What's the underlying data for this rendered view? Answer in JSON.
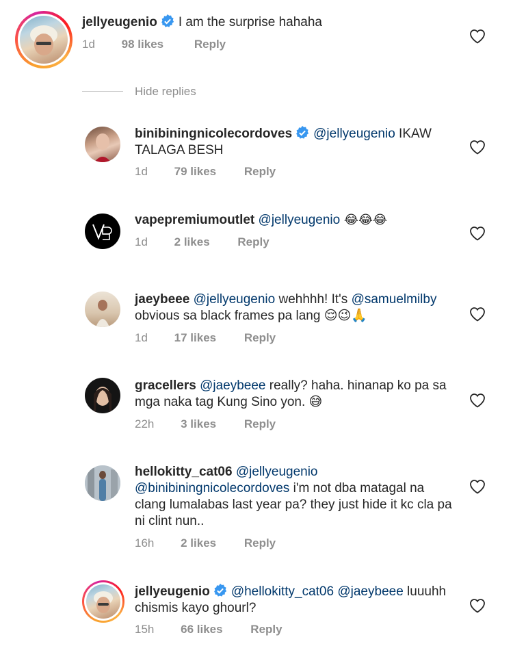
{
  "hide_replies": "Hide replies",
  "comments": [
    {
      "username": "jellyeugenio",
      "verified": true,
      "mention": "",
      "text": "I am the surprise hahaha",
      "time": "1d",
      "likes": "98 likes",
      "reply": "Reply",
      "avatar": "jelly-avatar"
    },
    {
      "username": "binibiningnicolecordoves",
      "verified": true,
      "mention": "@jellyeugenio",
      "text": " IKAW TALAGA BESH",
      "time": "1d",
      "likes": "79 likes",
      "reply": "Reply",
      "avatar": "nicole-avatar"
    },
    {
      "username": "vapepremiumoutlet",
      "verified": false,
      "mention": "@jellyeugenio",
      "text": " 😂😂😂",
      "time": "1d",
      "likes": "2 likes",
      "reply": "Reply",
      "avatar": "vape-avatar"
    },
    {
      "username": "jaeybeee",
      "verified": false,
      "mention": "@jellyeugenio",
      "text": " wehhhh! It's ",
      "mention2": "@samuelmilby",
      "text2": " obvious sa black frames pa lang 😌😉🙏",
      "time": "1d",
      "likes": "17 likes",
      "reply": "Reply",
      "avatar": "jaey-avatar"
    },
    {
      "username": "gracellers",
      "verified": false,
      "mention": "@jaeybeee",
      "text": " really? haha. hinanap ko pa sa mga naka tag Kung Sino yon. 😅",
      "time": "22h",
      "likes": "3 likes",
      "reply": "Reply",
      "avatar": "grace-avatar"
    },
    {
      "username": "hellokitty_cat06",
      "verified": false,
      "mention": "@jellyeugenio",
      "mention2": "@binibiningnicolecordoves",
      "text2": " i'm not dba matagal na clang lumalabas last year pa? they just hide it kc cla pa ni clint nun..",
      "time": "16h",
      "likes": "2 likes",
      "reply": "Reply",
      "avatar": "hellokitty-avatar"
    },
    {
      "username": "jellyeugenio",
      "verified": true,
      "mention": "@hellokitty_cat06",
      "mention2": "@jaeybeee",
      "text2": " luuuhh chismis kayo ghourl?",
      "time": "15h",
      "likes": "66 likes",
      "reply": "Reply",
      "avatar": "jelly-avatar"
    }
  ],
  "colors": {
    "text": "#262626",
    "mention": "#00376b",
    "meta": "#8e8e8e",
    "verified": "#3897f0"
  }
}
